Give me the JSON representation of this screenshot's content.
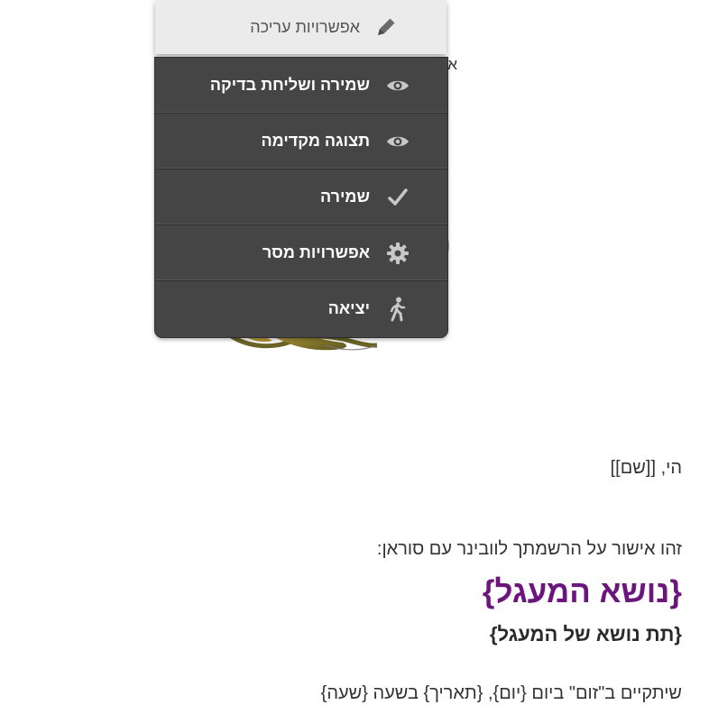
{
  "background": {
    "peek_text": "או"
  },
  "edit_menu": {
    "header_label": "אפשרויות עריכה",
    "header_icon": "pencil-icon",
    "items": [
      {
        "label": "שמירה ושליחת בדיקה",
        "icon": "eye-icon"
      },
      {
        "label": "תצוגה מקדימה",
        "icon": "eye-icon"
      },
      {
        "label": "שמירה",
        "icon": "checkmark-icon"
      },
      {
        "label": "אפשרויות מסר",
        "icon": "gear-icon"
      },
      {
        "label": "יציאה",
        "icon": "walking-person-icon"
      }
    ]
  },
  "email": {
    "greeting": "הי,  [[שם]]",
    "confirmation": "זהו אישור על הרשמתך לוובינר עם סוראן:",
    "topic": "{נושא המעגל}",
    "subtopic": "{תת נושא של המעגל}",
    "schedule": "שיתקיים ב\"זום\" ביום {יום}, {תאריך} בשעה {שעה}"
  },
  "colors": {
    "topic": "#6c157c",
    "menu_bg": "#454545",
    "header_bg": "#ebebeb"
  }
}
